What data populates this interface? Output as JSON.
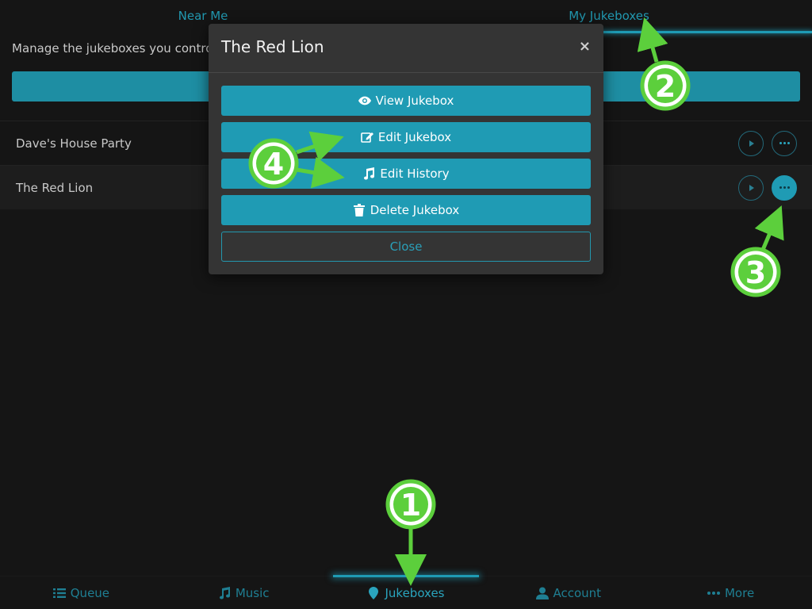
{
  "top_tabs": [
    {
      "label": "Near Me"
    },
    {
      "label": "My Jukeboxes"
    }
  ],
  "page": {
    "description": "Manage the jukeboxes you contro"
  },
  "jukeboxes": [
    {
      "name": "Dave's House Party"
    },
    {
      "name": "The Red Lion"
    }
  ],
  "modal": {
    "title": "The Red Lion",
    "close_symbol": "×",
    "buttons": {
      "view": "View Jukebox",
      "edit": "Edit Jukebox",
      "history": "Edit History",
      "delete": "Delete Jukebox",
      "close": "Close"
    }
  },
  "bottom_nav": [
    {
      "label": "Queue",
      "icon": "list-icon"
    },
    {
      "label": "Music",
      "icon": "music-note-icon"
    },
    {
      "label": "Jukeboxes",
      "icon": "map-pin-icon"
    },
    {
      "label": "Account",
      "icon": "user-icon"
    },
    {
      "label": "More",
      "icon": "ellipsis-icon"
    }
  ],
  "annotations": {
    "badge_1": "1",
    "badge_2": "2",
    "badge_3": "3",
    "badge_4": "4"
  },
  "colors": {
    "accent": "#1f9bb4",
    "background": "#151515",
    "modal": "#343434",
    "annotation": "#5ccf3c"
  }
}
